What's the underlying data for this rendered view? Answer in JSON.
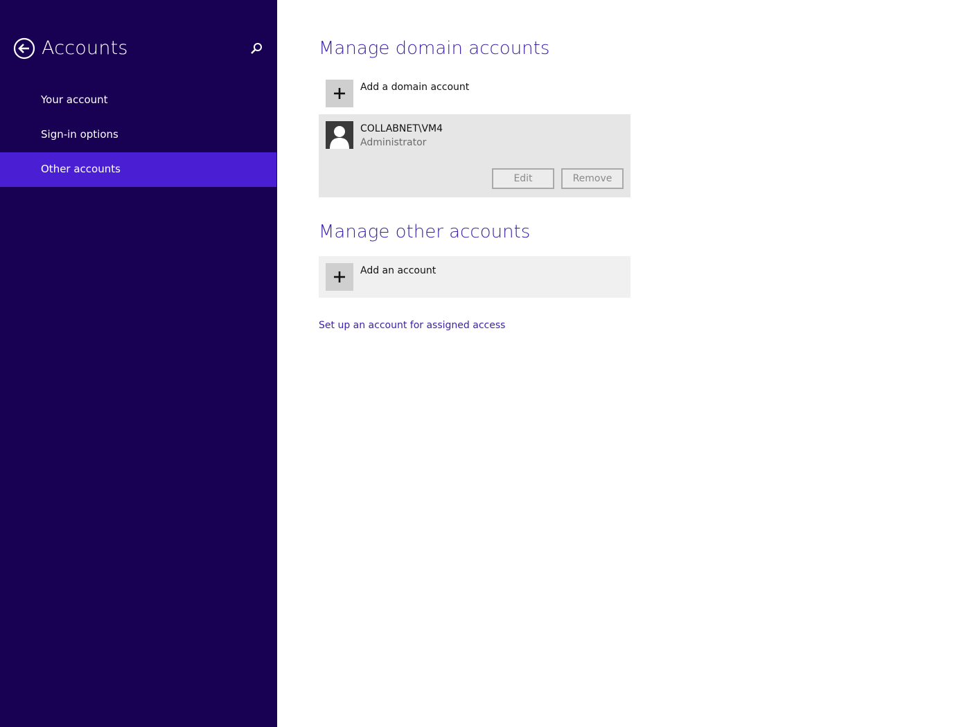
{
  "sidebar": {
    "title": "Accounts",
    "items": [
      {
        "label": "Your account",
        "active": false
      },
      {
        "label": "Sign-in options",
        "active": false
      },
      {
        "label": "Other accounts",
        "active": true
      }
    ]
  },
  "main": {
    "domain_section": {
      "title": "Manage domain accounts",
      "add_label": "Add a domain account",
      "account": {
        "name": "COLLABNET\\VM4",
        "role": "Administrator",
        "edit_label": "Edit",
        "remove_label": "Remove"
      }
    },
    "other_section": {
      "title": "Manage other accounts",
      "add_label": "Add an account"
    },
    "assigned_access_link": "Set up an account for assigned access"
  },
  "icons": {
    "back": "back-arrow-circle-icon",
    "search": "search-icon",
    "plus": "plus-icon",
    "avatar": "user-avatar-icon"
  },
  "colors": {
    "sidebar_bg": "#180052",
    "active_item": "#4a1fd4",
    "accent_text": "#3b1fa8"
  }
}
